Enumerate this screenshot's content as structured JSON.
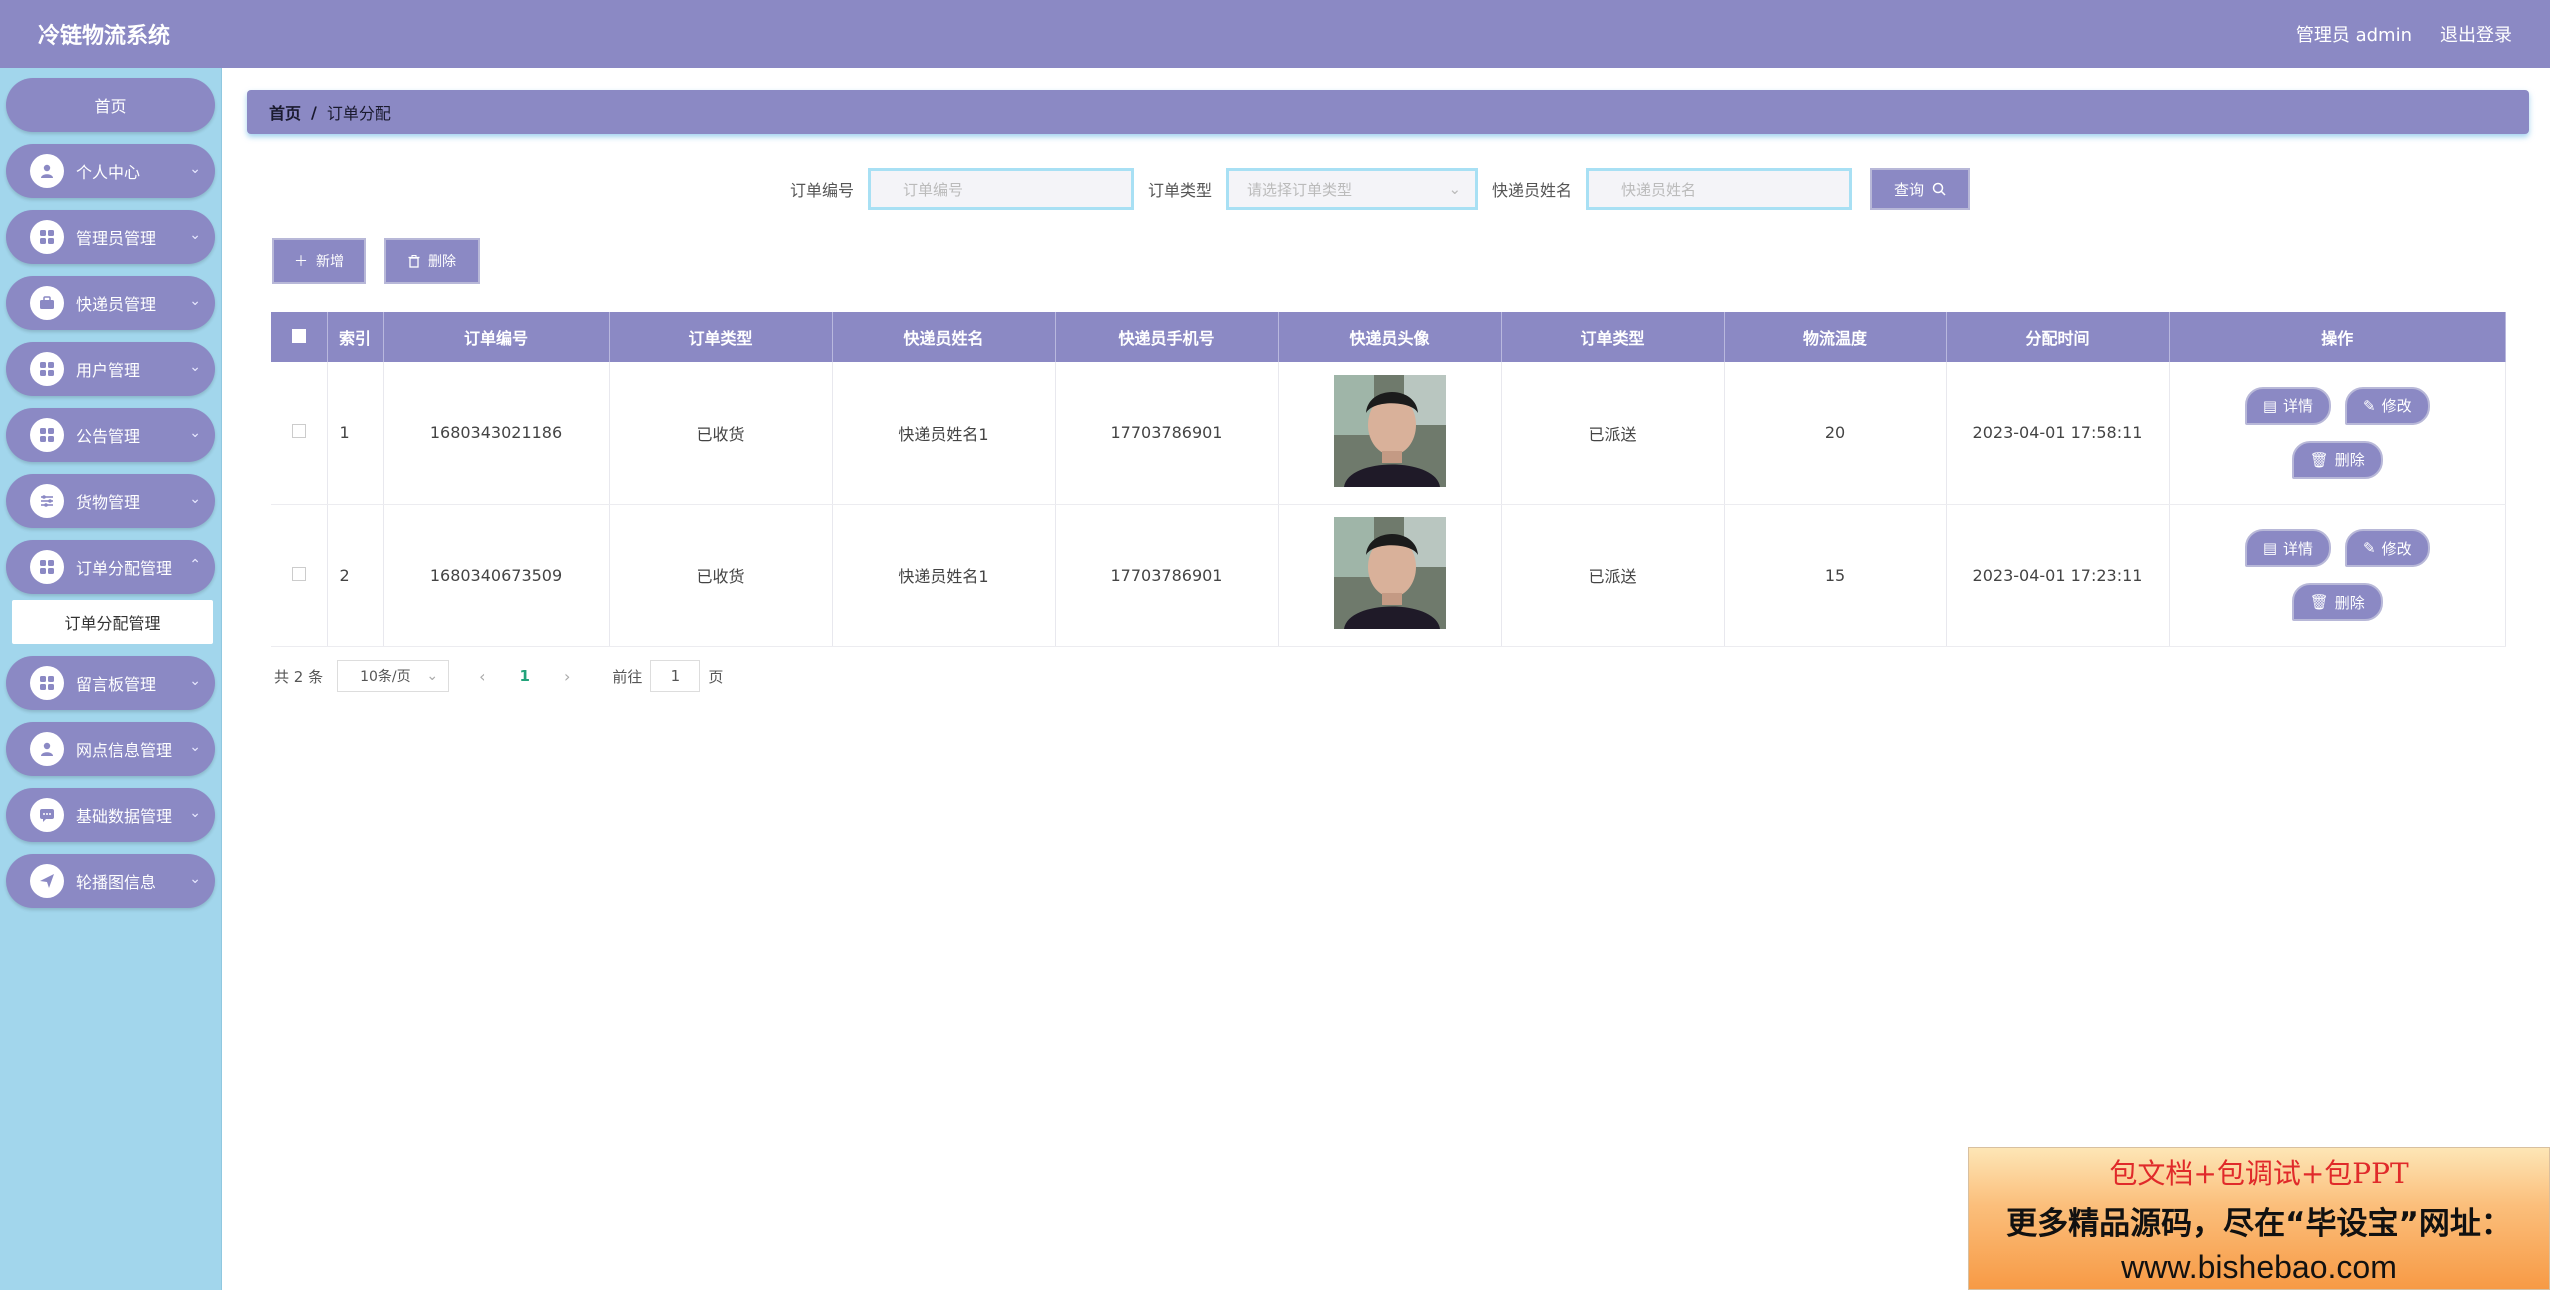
{
  "header": {
    "title": "冷链物流系统",
    "user": "管理员 admin",
    "logout": "退出登录"
  },
  "sidebar": {
    "home": "首页",
    "items": [
      {
        "label": "个人中心",
        "icon": "user-icon"
      },
      {
        "label": "管理员管理",
        "icon": "grid-icon"
      },
      {
        "label": "快递员管理",
        "icon": "briefcase-icon"
      },
      {
        "label": "用户管理",
        "icon": "grid-icon"
      },
      {
        "label": "公告管理",
        "icon": "grid-icon"
      },
      {
        "label": "货物管理",
        "icon": "sliders-icon"
      },
      {
        "label": "订单分配管理",
        "icon": "grid-icon"
      },
      {
        "label": "留言板管理",
        "icon": "grid-icon"
      },
      {
        "label": "网点信息管理",
        "icon": "user-icon"
      },
      {
        "label": "基础数据管理",
        "icon": "chat-icon"
      },
      {
        "label": "轮播图信息",
        "icon": "send-icon"
      }
    ],
    "submenu": "订单分配管理"
  },
  "breadcrumb": {
    "home": "首页",
    "sep": "/",
    "current": "订单分配"
  },
  "search": {
    "order_no_label": "订单编号",
    "order_no_placeholder": "订单编号",
    "order_type_label": "订单类型",
    "order_type_placeholder": "请选择订单类型",
    "courier_label": "快递员姓名",
    "courier_placeholder": "快递员姓名",
    "query": "查询"
  },
  "actions": {
    "add": "新增",
    "delete": "删除"
  },
  "table": {
    "headers": [
      "索引",
      "订单编号",
      "订单类型",
      "快递员姓名",
      "快递员手机号",
      "快递员头像",
      "订单类型",
      "物流温度",
      "分配时间",
      "操作"
    ],
    "rows": [
      {
        "index": "1",
        "order_no": "1680343021186",
        "order_type": "已收货",
        "courier": "快递员姓名1",
        "phone": "17703786901",
        "status": "已派送",
        "temp": "20",
        "time": "2023-04-01 17:58:11"
      },
      {
        "index": "2",
        "order_no": "1680340673509",
        "order_type": "已收货",
        "courier": "快递员姓名1",
        "phone": "17703786901",
        "status": "已派送",
        "temp": "15",
        "time": "2023-04-01 17:23:11"
      }
    ],
    "ops": {
      "detail": "详情",
      "edit": "修改",
      "delete": "删除"
    }
  },
  "pager": {
    "total": "共 2 条",
    "page_size": "10条/页",
    "current": "1",
    "goto_label": "前往",
    "goto_value": "1",
    "page_suffix": "页"
  },
  "watermark": {
    "line1": "包文档+包调试+包PPT",
    "line2": "更多精品源码，尽在“毕设宝”网址：",
    "line3": "www.bishebao.com"
  }
}
